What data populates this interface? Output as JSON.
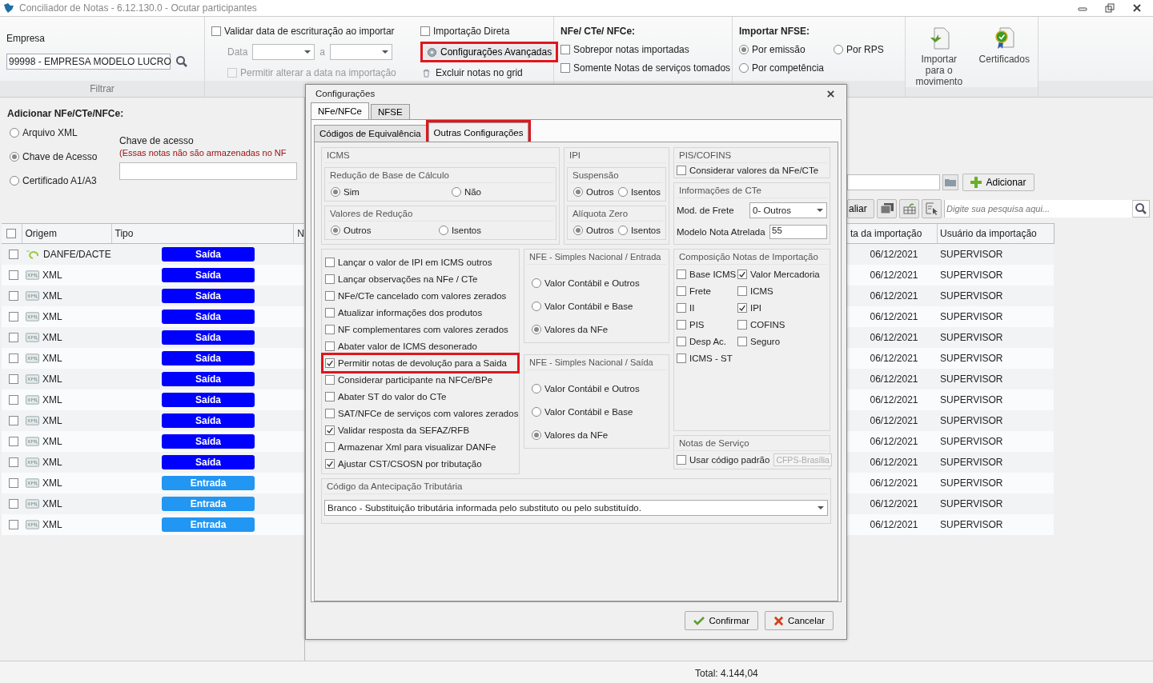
{
  "window": {
    "title": "Conciliador de Notas - 6.12.130.0  -  Ocutar participantes"
  },
  "toolbar": {
    "empresa": {
      "label": "Empresa",
      "value": "99998 - EMPRESA MODELO LUCRO",
      "group_label": "Filtrar"
    },
    "validar": {
      "label": "Validar data de escrituração ao importar",
      "checked": false
    },
    "data": {
      "label": "Data",
      "separator": "a",
      "disabled": true
    },
    "permitir_alterar": {
      "label": "Permitir alterar a data na importação",
      "checked": false,
      "disabled": true
    },
    "importacao_direta": {
      "label": "Importação Direta",
      "checked": false
    },
    "config_button": {
      "label": "Configurações Avançadas",
      "highlighted": true
    },
    "excluir": {
      "label": "Excluir notas no grid"
    },
    "nfe_group": {
      "title": "NFe/ CTe/ NFCe:",
      "options": [
        {
          "label": "Sobrepor notas importadas",
          "checked": false
        },
        {
          "label": "Somente Notas de serviços tomados",
          "checked": false
        }
      ]
    },
    "nfse_group": {
      "title": "Importar NFSE:",
      "options": [
        {
          "label": "Por emissão",
          "selected": true
        },
        {
          "label": "Por RPS",
          "selected": false
        },
        {
          "label": "Por competência",
          "selected": false
        }
      ]
    },
    "actions": [
      {
        "label": "Importar para o movimento",
        "kind": "import"
      },
      {
        "label": "Certificados",
        "kind": "certificate"
      }
    ]
  },
  "add_panel": {
    "title": "Adicionar NFe/CTe/NFCe:",
    "sources": [
      {
        "label": "Arquivo XML",
        "selected": false
      },
      {
        "label": "Chave de Acesso",
        "selected": true
      },
      {
        "label": "Certificado A1/A3",
        "selected": false
      }
    ],
    "key_label": "Chave de acesso",
    "key_note": "(Essas notas não são armazenadas no NF"
  },
  "right_panel": {
    "add_button": "Adicionar",
    "partial_button": "aliar",
    "search_placeholder": "Digite sua pesquisa aqui..."
  },
  "grid": {
    "header_checked": false,
    "columns_left": [
      "Origem",
      "Tipo",
      "N"
    ],
    "columns_right": [
      "ta da importação",
      "Usuário da importação"
    ],
    "rows": [
      {
        "checked": false,
        "kind": "danfe",
        "origem": "DANFE/DACTE",
        "tipo": "Saída",
        "color": "#0000ff",
        "date": "06/12/2021",
        "user": "SUPERVISOR"
      },
      {
        "checked": false,
        "kind": "xml",
        "origem": "XML",
        "tipo": "Saída",
        "color": "#0000ff",
        "date": "06/12/2021",
        "user": "SUPERVISOR"
      },
      {
        "checked": false,
        "kind": "xml",
        "origem": "XML",
        "tipo": "Saída",
        "color": "#0000ff",
        "date": "06/12/2021",
        "user": "SUPERVISOR"
      },
      {
        "checked": false,
        "kind": "xml",
        "origem": "XML",
        "tipo": "Saída",
        "color": "#0000ff",
        "date": "06/12/2021",
        "user": "SUPERVISOR"
      },
      {
        "checked": false,
        "kind": "xml",
        "origem": "XML",
        "tipo": "Saída",
        "color": "#0000ff",
        "date": "06/12/2021",
        "user": "SUPERVISOR"
      },
      {
        "checked": false,
        "kind": "xml",
        "origem": "XML",
        "tipo": "Saída",
        "color": "#0000ff",
        "date": "06/12/2021",
        "user": "SUPERVISOR"
      },
      {
        "checked": false,
        "kind": "xml",
        "origem": "XML",
        "tipo": "Saída",
        "color": "#0000ff",
        "date": "06/12/2021",
        "user": "SUPERVISOR"
      },
      {
        "checked": false,
        "kind": "xml",
        "origem": "XML",
        "tipo": "Saída",
        "color": "#0000ff",
        "date": "06/12/2021",
        "user": "SUPERVISOR"
      },
      {
        "checked": false,
        "kind": "xml",
        "origem": "XML",
        "tipo": "Saída",
        "color": "#0000ff",
        "date": "06/12/2021",
        "user": "SUPERVISOR"
      },
      {
        "checked": false,
        "kind": "xml",
        "origem": "XML",
        "tipo": "Saída",
        "color": "#0000ff",
        "date": "06/12/2021",
        "user": "SUPERVISOR"
      },
      {
        "checked": false,
        "kind": "xml",
        "origem": "XML",
        "tipo": "Saída",
        "color": "#0000ff",
        "date": "06/12/2021",
        "user": "SUPERVISOR"
      },
      {
        "checked": false,
        "kind": "xml",
        "origem": "XML",
        "tipo": "Entrada",
        "color": "#2196f3",
        "date": "06/12/2021",
        "user": "SUPERVISOR"
      },
      {
        "checked": false,
        "kind": "xml",
        "origem": "XML",
        "tipo": "Entrada",
        "color": "#2196f3",
        "date": "06/12/2021",
        "user": "SUPERVISOR"
      },
      {
        "checked": false,
        "kind": "xml",
        "origem": "XML",
        "tipo": "Entrada",
        "color": "#2196f3",
        "date": "06/12/2021",
        "user": "SUPERVISOR"
      }
    ]
  },
  "status_bar": {
    "total": "Total: 4.144,04"
  },
  "dialog": {
    "title": "Configurações",
    "tabs": [
      {
        "label": "NFe/NFCe",
        "selected": true
      },
      {
        "label": "NFSE",
        "selected": false
      }
    ],
    "subtabs": [
      {
        "label": "Códigos de Equivalência",
        "selected": false,
        "highlighted": false
      },
      {
        "label": "Outras Configurações",
        "selected": true,
        "highlighted": true
      }
    ],
    "icms": {
      "title": "ICMS",
      "groups": [
        {
          "title": "Redução de Base de Cálculo",
          "options": [
            {
              "label": "Sim",
              "selected": true
            },
            {
              "label": "Não",
              "selected": false
            }
          ]
        },
        {
          "title": "Valores de Redução",
          "options": [
            {
              "label": "Outros",
              "selected": true
            },
            {
              "label": "Isentos",
              "selected": false
            }
          ]
        }
      ]
    },
    "ipi": {
      "title": "IPI",
      "groups": [
        {
          "title": "Suspensão",
          "options": [
            {
              "label": "Outros",
              "selected": true
            },
            {
              "label": "Isentos",
              "selected": false
            }
          ]
        },
        {
          "title": "Alíquota Zero",
          "options": [
            {
              "label": "Outros",
              "selected": true
            },
            {
              "label": "Isentos",
              "selected": false
            }
          ]
        }
      ]
    },
    "pis_cofins": {
      "title": "PIS/COFINS",
      "option": {
        "label": "Considerar valores da NFe/CTe",
        "checked": false
      }
    },
    "cte_info": {
      "title": "Informações de CTe",
      "frete_label": "Mod. de Frete",
      "frete_value": "0- Outros",
      "modelo_label": "Modelo Nota Atrelada",
      "modelo_value": "55"
    },
    "options": [
      {
        "label": "Lançar o valor de IPI em ICMS outros",
        "checked": false,
        "highlighted": false
      },
      {
        "label": "Lançar observações na NFe / CTe",
        "checked": false,
        "highlighted": false
      },
      {
        "label": "NFe/CTe cancelado com valores zerados",
        "checked": false,
        "highlighted": false
      },
      {
        "label": "Atualizar informações dos produtos",
        "checked": false,
        "highlighted": false
      },
      {
        "label": "NF complementares com valores zerados",
        "checked": false,
        "highlighted": false
      },
      {
        "label": "Abater valor de ICMS desonerado",
        "checked": false,
        "highlighted": false
      },
      {
        "label": "Permitir notas de devolução para a Saida",
        "checked": true,
        "highlighted": true
      },
      {
        "label": "Considerar participante na NFCe/BPe",
        "checked": false,
        "highlighted": false
      },
      {
        "label": "Abater ST do valor do CTe",
        "checked": false,
        "highlighted": false
      },
      {
        "label": "SAT/NFCe de serviços com valores zerados",
        "checked": false,
        "highlighted": false
      },
      {
        "label": "Validar resposta da SEFAZ/RFB",
        "checked": true,
        "highlighted": false
      },
      {
        "label": "Armazenar Xml para visualizar DANFe",
        "checked": false,
        "highlighted": false
      },
      {
        "label": "Ajustar CST/CSOSN por tributação",
        "checked": true,
        "highlighted": false
      }
    ],
    "simples": [
      {
        "title": "NFE - Simples Nacional / Entrada",
        "options": [
          {
            "label": "Valor Contábil e Outros",
            "selected": false
          },
          {
            "label": "Valor Contábil e Base",
            "selected": false
          },
          {
            "label": "Valores da NFe",
            "selected": true
          }
        ]
      },
      {
        "title": "NFE - Simples Nacional / Saída",
        "options": [
          {
            "label": "Valor Contábil e Outros",
            "selected": false
          },
          {
            "label": "Valor Contábil e Base",
            "selected": false
          },
          {
            "label": "Valores da NFe",
            "selected": true
          }
        ]
      }
    ],
    "composicao": {
      "title": "Composição Notas de Importação",
      "options": [
        {
          "label": "Base ICMS",
          "checked": false
        },
        {
          "label": "Valor Mercadoria",
          "checked": true
        },
        {
          "label": "Frete",
          "checked": false
        },
        {
          "label": "ICMS",
          "checked": false
        },
        {
          "label": "II",
          "checked": false
        },
        {
          "label": "IPI",
          "checked": true
        },
        {
          "label": "PIS",
          "checked": false
        },
        {
          "label": "COFINS",
          "checked": false
        },
        {
          "label": "Desp Ac.",
          "checked": false
        },
        {
          "label": "Seguro",
          "checked": false
        },
        {
          "label": "ICMS - ST",
          "checked": false
        }
      ]
    },
    "servico": {
      "title": "Notas de Serviço",
      "option": {
        "label": "Usar código padrão",
        "checked": false
      },
      "code": "CFPS-Brasília"
    },
    "antecipacao": {
      "title": "Código da Antecipação Tributária",
      "value": "Branco - Substituição tributária informada pelo substituto ou pelo substituído."
    },
    "buttons": [
      {
        "label": "Confirmar",
        "kind": "confirm"
      },
      {
        "label": "Cancelar",
        "kind": "cancel"
      }
    ]
  }
}
